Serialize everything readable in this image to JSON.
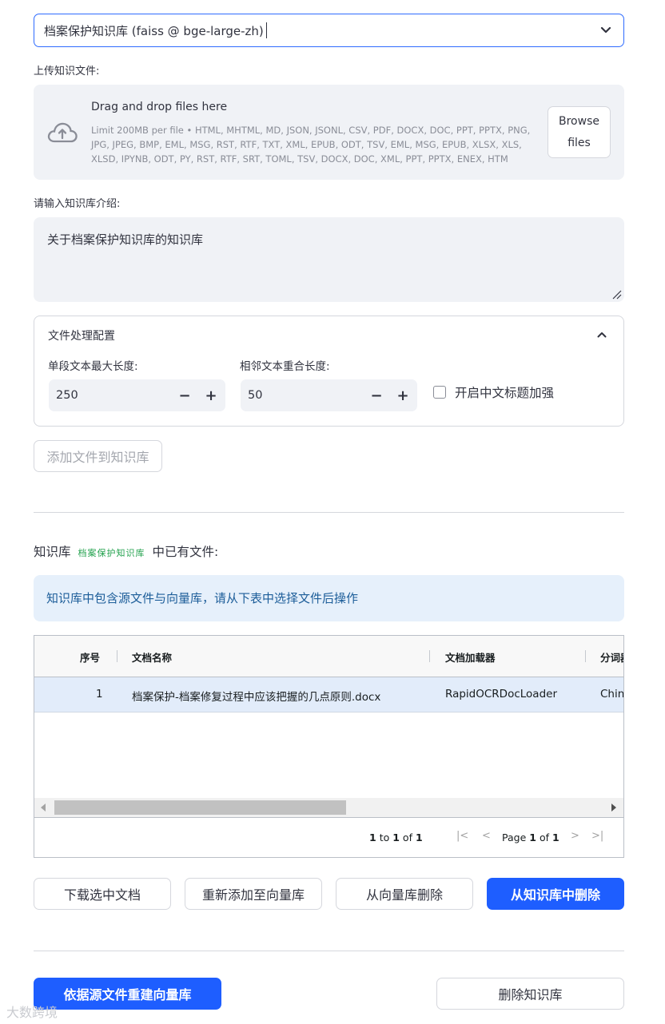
{
  "kb_select": {
    "value": "档案保护知识库 (faiss @ bge-large-zh)",
    "chevron_icon": "chevron-down-icon"
  },
  "upload": {
    "label": "上传知识文件:",
    "title": "Drag and drop files here",
    "limit": "Limit 200MB per file • HTML, MHTML, MD, JSON, JSONL, CSV, PDF, DOCX, DOC, PPT, PPTX, PNG, JPG, JPEG, BMP, EML, MSG, RST, RTF, TXT, XML, EPUB, ODT, TSV, EML, MSG, EPUB, XLSX, XLS, XLSD, IPYNB, ODT, PY, RST, RTF, SRT, TOML, TSV, DOCX, DOC, XML, PPT, PPTX, ENEX, HTM",
    "browse_line1": "Browse",
    "browse_line2": "files",
    "icon": "cloud-upload-icon"
  },
  "intro": {
    "label": "请输入知识库介绍:",
    "value": "关于档案保护知识库的知识库"
  },
  "config": {
    "title": "文件处理配置",
    "chunk_size_label": "单段文本最大长度:",
    "chunk_size_value": "250",
    "overlap_label": "相邻文本重合长度:",
    "overlap_value": "50",
    "zh_title_label": "开启中文标题加强",
    "zh_title_checked": false,
    "minus": "−",
    "plus": "+"
  },
  "add_button": "添加文件到知识库",
  "files_section": {
    "prefix": "知识库",
    "kb_name": "档案保护知识库",
    "suffix": "中已有文件:",
    "info": "知识库中包含源文件与向量库，请从下表中选择文件后操作"
  },
  "grid": {
    "columns": [
      "序号",
      "文档名称",
      "文档加载器",
      "分词器"
    ],
    "rows": [
      {
        "index": "1",
        "name": "档案保护-档案修复过程中应该把握的几点原则.docx",
        "loader": "RapidOCRDocLoader",
        "splitter": "ChineseRecursiveTextSplitter"
      }
    ],
    "summary_from": "1",
    "summary_to_word": "to",
    "summary_to": "1",
    "summary_of_word": "of",
    "summary_total": "1",
    "page_word": "Page",
    "page_current": "1",
    "page_of_word": "of",
    "page_total": "1"
  },
  "actions": {
    "download": "下载选中文档",
    "re_add": "重新添加至向量库",
    "delete_vs": "从向量库删除",
    "delete_kb_file": "从知识库中删除"
  },
  "bottom": {
    "rebuild": "依据源文件重建向量库",
    "delete_kb": "删除知识库"
  },
  "watermark": "大数跨境",
  "colors": {
    "primary": "#1e5eff",
    "info_bg": "#e6f0fb",
    "info_text": "#1c5d99",
    "tag_green": "#21a14c"
  }
}
